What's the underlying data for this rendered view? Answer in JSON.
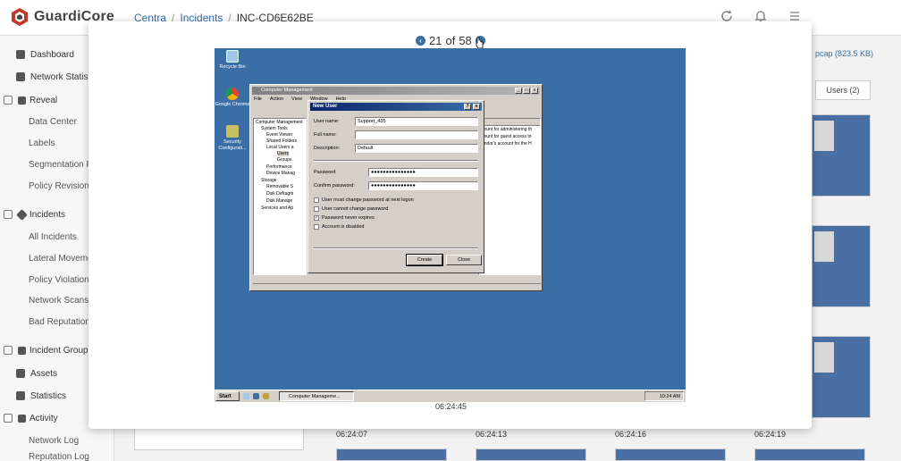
{
  "app": {
    "name": "GuardiCore",
    "brand_color": "#c0392b",
    "breadcrumbs": [
      "Centra",
      "Incidents",
      "INC-CD6E62BE"
    ]
  },
  "topbar_icons": [
    "refresh-icon",
    "bell-icon",
    "settings-icon"
  ],
  "sidebar": {
    "items": [
      {
        "label": "Dashboard",
        "icon": "dashboard-icon",
        "level": "top"
      },
      {
        "label": "Network Statistics",
        "icon": "network-icon",
        "level": "top"
      },
      {
        "label": "Reveal",
        "icon": "reveal-icon",
        "level": "group"
      },
      {
        "label": "Data Center",
        "level": "sub"
      },
      {
        "label": "Labels",
        "level": "sub"
      },
      {
        "label": "Segmentation Po",
        "level": "sub"
      },
      {
        "label": "Policy Revisions",
        "level": "sub"
      },
      {
        "label": "Incidents",
        "icon": "incidents-icon",
        "level": "group"
      },
      {
        "label": "All Incidents",
        "level": "sub"
      },
      {
        "label": "Lateral Moveme",
        "level": "sub"
      },
      {
        "label": "Policy Violations",
        "level": "sub"
      },
      {
        "label": "Network Scans",
        "level": "sub"
      },
      {
        "label": "Bad Reputation",
        "level": "sub"
      },
      {
        "label": "Incident Groups",
        "icon": "incident-groups-icon",
        "level": "group"
      },
      {
        "label": "Assets",
        "icon": "assets-icon",
        "level": "top"
      },
      {
        "label": "Statistics",
        "icon": "statistics-icon",
        "level": "top"
      },
      {
        "label": "Activity",
        "icon": "activity-icon",
        "level": "group"
      },
      {
        "label": "Network Log",
        "level": "sub"
      },
      {
        "label": "Reputation Log",
        "level": "sub"
      }
    ]
  },
  "right_panel": {
    "pcap_label": "pcap (823.5 KB)",
    "users_tab": "Users (2)"
  },
  "bottom_timestamps": [
    "06:24:07",
    "06:24:13",
    "06:24:16",
    "06:24:19"
  ],
  "modal": {
    "pager": {
      "current": "21",
      "of_word": "of",
      "total": "58"
    },
    "timestamp": "06:24:45"
  },
  "screenshot": {
    "desktop_icons": [
      {
        "label": "Recycle Bin",
        "icon": "recycle-bin-icon"
      },
      {
        "label": "Google Chrome",
        "icon": "chrome-icon"
      },
      {
        "label": "Security Configurati...",
        "icon": "security-config-icon"
      }
    ],
    "taskbar": {
      "start": "Start",
      "task": "Computer Manageme...",
      "clock": "10:24 AM"
    },
    "cm_window": {
      "title": "Computer Management",
      "menu": [
        "File",
        "Action",
        "View",
        "Window",
        "Help"
      ],
      "tree": [
        "Computer Management",
        "System Tools",
        "Event Viewer",
        "Shared Folders",
        "Local Users a",
        "Users",
        "Groups",
        "Performance",
        "Device Manag",
        "Storage",
        "Removable S",
        "Disk Defragm",
        "Disk Manage",
        "Services and Ap"
      ],
      "right_header": "n",
      "right_lines": [
        "count for administering th",
        "count for guest access to",
        "endor's account for the H"
      ]
    },
    "new_user": {
      "title": "New User",
      "fields": [
        {
          "label": "User name:",
          "value": "Support_435"
        },
        {
          "label": "Full name:",
          "value": ""
        },
        {
          "label": "Description:",
          "value": "Default"
        },
        {
          "label": "Password:",
          "value": "●●●●●●●●●●●●●●●"
        },
        {
          "label": "Confirm password:",
          "value": "●●●●●●●●●●●●●●●"
        }
      ],
      "checks": [
        {
          "label": "User must change password at next logon",
          "checked": false
        },
        {
          "label": "User cannot change password",
          "checked": false
        },
        {
          "label": "Password never expires",
          "checked": true
        },
        {
          "label": "Account is disabled",
          "checked": false
        }
      ],
      "create_label": "Create",
      "close_label": "Close",
      "check_mark": "✓",
      "help_btn": "?",
      "close_btn": "x"
    }
  }
}
